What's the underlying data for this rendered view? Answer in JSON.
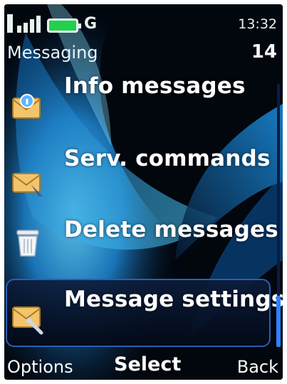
{
  "status": {
    "network_mode": "G",
    "time": "13:32"
  },
  "header": {
    "title": "Messaging",
    "count": "14"
  },
  "menu": {
    "items": [
      {
        "label": "Info messages",
        "icon": "info-message-envelope-icon",
        "selected": false
      },
      {
        "label": "Serv. commands",
        "icon": "service-command-envelope-icon",
        "selected": false
      },
      {
        "label": "Delete messages",
        "icon": "trash-bin-icon",
        "selected": false
      },
      {
        "label": "Message settings",
        "icon": "message-settings-envelope-icon",
        "selected": true
      }
    ]
  },
  "softkeys": {
    "left": "Options",
    "center": "Select",
    "right": "Back"
  },
  "colors": {
    "accent": "#2b82ff",
    "battery": "#20d24a",
    "background": "#02060d"
  }
}
